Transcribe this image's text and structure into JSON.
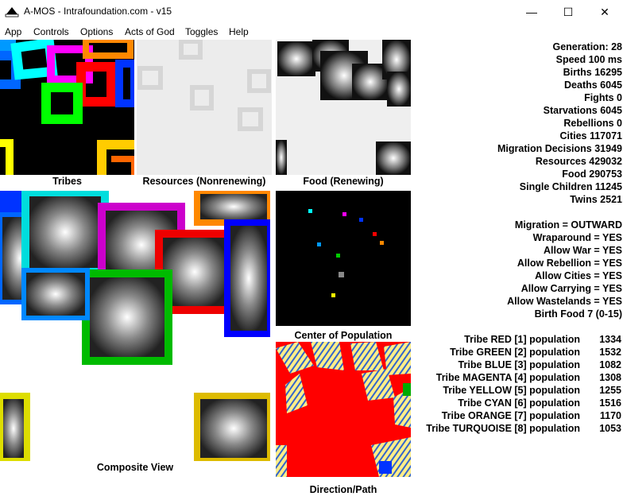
{
  "window": {
    "title": "A-MOS - Intrafoundation.com - v15",
    "minimize_glyph": "—",
    "maximize_glyph": "☐",
    "close_glyph": "✕"
  },
  "menu": [
    "App",
    "Controls",
    "Options",
    "Acts of God",
    "Toggles",
    "Help"
  ],
  "captions": {
    "tribes": "Tribes",
    "resources": "Resources (Nonrenewing)",
    "food": "Food (Renewing)",
    "composite": "Composite View",
    "center": "Center of Population",
    "direction": "Direction/Path"
  },
  "stats": [
    "Generation: 28",
    "Speed 100 ms",
    "Births 16295",
    "Deaths 6045",
    "Fights 0",
    "Starvations 6045",
    "Rebellions 0",
    "Cities 117071",
    "Migration Decisions 31949",
    "Resources 429032",
    "Food 290753",
    "Single Children 11245",
    "Twins 2521"
  ],
  "settings": [
    "Migration = OUTWARD",
    "Wraparound = YES",
    "Allow War = YES",
    "Allow Rebellion = YES",
    "Allow Cities = YES",
    "Allow Carrying = YES",
    "Allow Wastelands = YES",
    "Birth Food 7 (0-15)"
  ],
  "tribes": [
    {
      "label": "Tribe RED [1] population",
      "population": "1334",
      "color": "#ff0000"
    },
    {
      "label": "Tribe GREEN [2] population",
      "population": "1532",
      "color": "#00cc00"
    },
    {
      "label": "Tribe BLUE [3] population",
      "population": "1082",
      "color": "#0033ff"
    },
    {
      "label": "Tribe MAGENTA [4] population",
      "population": "1308",
      "color": "#ff00ff"
    },
    {
      "label": "Tribe YELLOW [5] population",
      "population": "1255",
      "color": "#ffff00"
    },
    {
      "label": "Tribe CYAN [6] population",
      "population": "1516",
      "color": "#00ffff"
    },
    {
      "label": "Tribe ORANGE [7] population",
      "population": "1170",
      "color": "#ff8800"
    },
    {
      "label": "Tribe TURQUOISE [8] population",
      "population": "1053",
      "color": "#0099ff"
    }
  ]
}
